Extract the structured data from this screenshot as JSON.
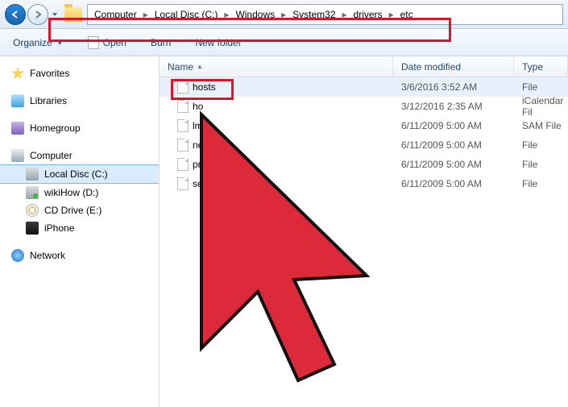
{
  "breadcrumb": [
    "Computer",
    "Local Disc (C:)",
    "Windows",
    "System32",
    "drivers",
    "etc"
  ],
  "toolbar": {
    "organize": "Organize",
    "open": "Open",
    "burn": "Burn",
    "newfolder": "New folder"
  },
  "sidebar": {
    "favorites": "Favorites",
    "libraries": "Libraries",
    "homegroup": "Homegroup",
    "computer": "Computer",
    "drives": [
      {
        "label": "Local Disc (C:)"
      },
      {
        "label": "wikiHow (D:)"
      },
      {
        "label": "CD Drive (E:)"
      },
      {
        "label": "iPhone"
      }
    ],
    "network": "Network"
  },
  "columns": {
    "name": "Name",
    "date": "Date modified",
    "type": "Type"
  },
  "files": [
    {
      "name": "hosts",
      "date": "3/6/2016 3:52 AM",
      "type": "File"
    },
    {
      "name": "ho",
      "date": "3/12/2016 2:35 AM",
      "type": "iCalendar Fil"
    },
    {
      "name": "lm",
      "date": "6/11/2009 5:00 AM",
      "type": "SAM File"
    },
    {
      "name": "ne",
      "date": "6/11/2009 5:00 AM",
      "type": "File"
    },
    {
      "name": "pro",
      "date": "6/11/2009 5:00 AM",
      "type": "File"
    },
    {
      "name": "ser",
      "date": "6/11/2009 5:00 AM",
      "type": "File"
    }
  ]
}
